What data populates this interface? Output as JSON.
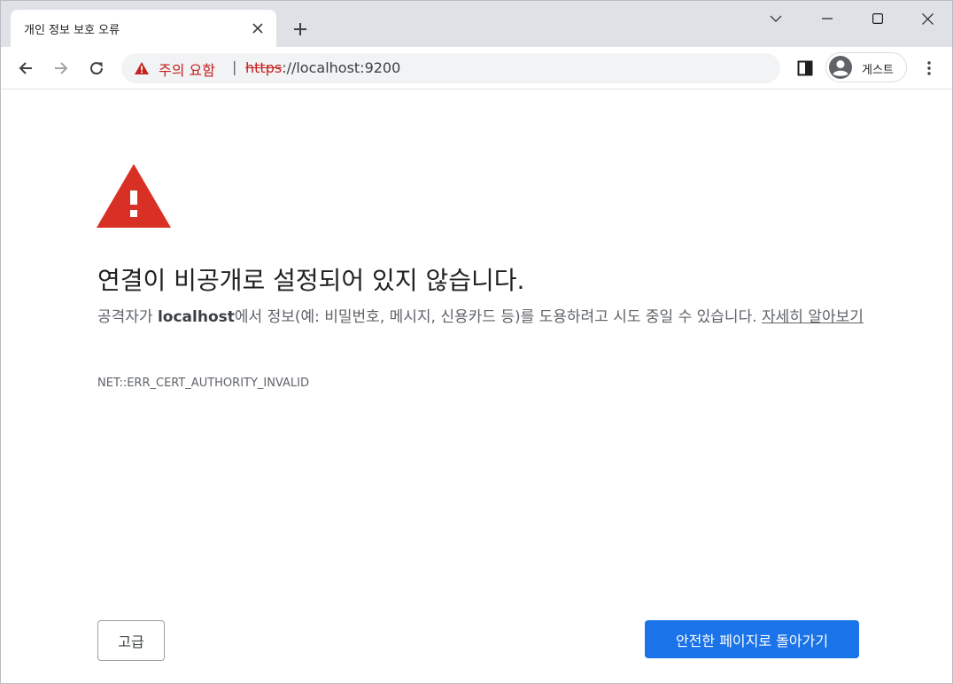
{
  "tab": {
    "title": "개인 정보 보호 오류",
    "new_tab_icon": "plus-icon",
    "close_icon": "close-icon"
  },
  "window_controls": {
    "dropdown_icon": "chevron-down-icon",
    "minimize_icon": "minimize-icon",
    "maximize_icon": "maximize-icon",
    "close_icon": "close-icon"
  },
  "toolbar": {
    "back_icon": "arrow-left-icon",
    "forward_icon": "arrow-right-icon",
    "reload_icon": "reload-icon",
    "security_chip_label": "주의 요함",
    "separator": "|",
    "url_scheme": "https",
    "url_rest": "://localhost:9200",
    "side_panel_icon": "side-panel-icon",
    "profile_label": "게스트",
    "menu_icon": "more-vert-icon"
  },
  "interstitial": {
    "heading": "연결이 비공개로 설정되어 있지 않습니다.",
    "explanation_before": "공격자가 ",
    "explanation_host": "localhost",
    "explanation_after": "에서 정보(예: 비밀번호, 메시지, 신용카드 등)를 도용하려고 시도 중일 수 있습니다. ",
    "learn_more_link": "자세히 알아보기",
    "error_code": "NET::ERR_CERT_AUTHORITY_INVALID",
    "advanced_button": "고급",
    "back_to_safety_button": "안전한 페이지로 돌아가기"
  },
  "colors": {
    "danger_red": "#d93025",
    "primary_blue": "#1a73e8",
    "tabstrip_bg": "#dee1e6"
  }
}
